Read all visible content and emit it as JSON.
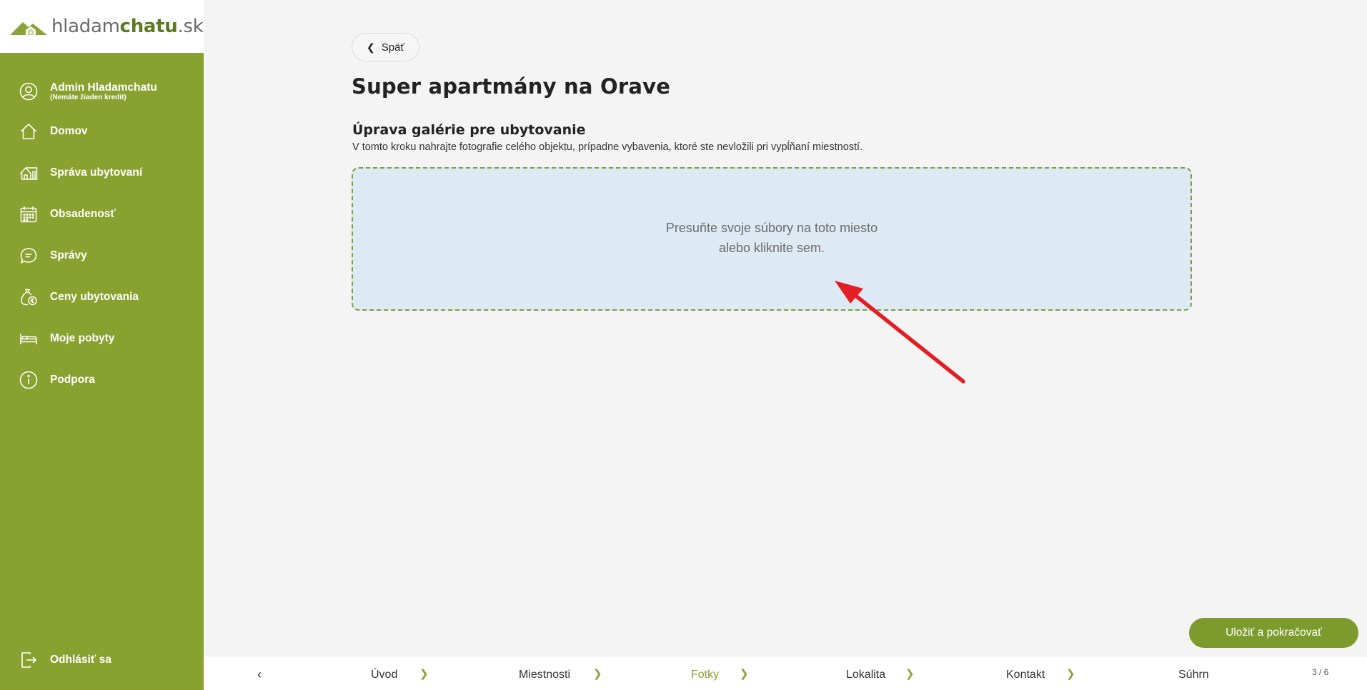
{
  "logo": {
    "part1": "hladam",
    "part2": "chatu",
    "part3": ".sk"
  },
  "sidebar": {
    "user": {
      "name": "Admin Hladamchatu",
      "sub": "(Nemáte žiaden kredit)"
    },
    "items": [
      {
        "label": "Domov",
        "icon": "home-icon"
      },
      {
        "label": "Správa ubytovaní",
        "icon": "cabin-icon"
      },
      {
        "label": "Obsadenosť",
        "icon": "calendar-icon"
      },
      {
        "label": "Správy",
        "icon": "message-icon"
      },
      {
        "label": "Ceny ubytovania",
        "icon": "money-icon"
      },
      {
        "label": "Moje pobyty",
        "icon": "bed-icon"
      },
      {
        "label": "Podpora",
        "icon": "info-icon"
      }
    ],
    "logout": "Odhlásiť sa"
  },
  "main": {
    "back_label": "Späť",
    "title": "Super apartmány na Orave",
    "section_title": "Úprava galérie pre ubytovanie",
    "section_desc": "V tomto kroku nahrajte fotografie celého objektu, prípadne vybavenia, ktoré ste nevložili pri vypĺňaní miestností.",
    "dropzone_line1": "Presuňte svoje súbory na toto miesto",
    "dropzone_line2": "alebo kliknite sem.",
    "save_label": "Uložiť a pokračovať"
  },
  "wizard": {
    "steps": [
      "Úvod",
      "Miestnosti",
      "Fotky",
      "Lokalita",
      "Kontakt",
      "Súhrn"
    ],
    "active_step": "Fotky",
    "counter": "3 / 6"
  },
  "colors": {
    "sidebar": "#89a12e",
    "accent": "#7d9a2c",
    "dropzone": "#dde9f3",
    "arrow": "#e31e24"
  }
}
